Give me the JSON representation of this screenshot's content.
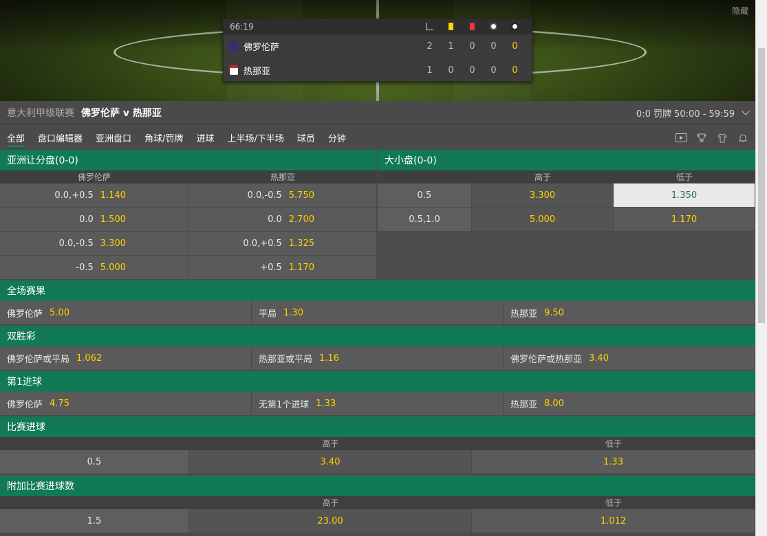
{
  "header": {
    "hide_label": "隐藏"
  },
  "scoreboard": {
    "time": "66:19",
    "teams": [
      {
        "name": "佛罗伦萨",
        "corners": "2",
        "yellow": "1",
        "red": "0",
        "pen": "0",
        "goals": "0",
        "shirt_color": "#3a2a7a"
      },
      {
        "name": "热那亚",
        "corners": "1",
        "yellow": "0",
        "red": "0",
        "pen": "0",
        "goals": "0",
        "shirt_color": "#c62828"
      }
    ],
    "icons": [
      "corner-icon",
      "yellow-card-icon",
      "red-card-icon",
      "penalty-icon",
      "goal-icon"
    ]
  },
  "title": {
    "league": "意大利甲级联赛",
    "match": "佛罗伦萨 v 热那亚",
    "status": "0:0 罚牌 50:00 - 59:59"
  },
  "tabs": [
    "全部",
    "盘口编辑器",
    "亚洲盘口",
    "角球/罚牌",
    "进球",
    "上半场/下半场",
    "球员",
    "分钟"
  ],
  "handicap": {
    "title": "亚洲让分盘(0-0)",
    "col_home": "佛罗伦萨",
    "col_away": "热那亚",
    "rows": [
      {
        "h_line": "0.0,+0.5",
        "h_odd": "1.140",
        "a_line": "0.0,-0.5",
        "a_odd": "5.750"
      },
      {
        "h_line": "0.0",
        "h_odd": "1.500",
        "a_line": "0.0",
        "a_odd": "2.700"
      },
      {
        "h_line": "0.0,-0.5",
        "h_odd": "3.300",
        "a_line": "0.0,+0.5",
        "a_odd": "1.325"
      },
      {
        "h_line": "-0.5",
        "h_odd": "5.000",
        "a_line": "+0.5",
        "a_odd": "1.170"
      }
    ]
  },
  "totals": {
    "title": "大小盘(0-0)",
    "col_over": "高于",
    "col_under": "低于",
    "rows": [
      {
        "line": "0.5",
        "over": "3.300",
        "under": "1.350"
      },
      {
        "line": "0.5,1.0",
        "over": "5.000",
        "under": "1.170"
      }
    ]
  },
  "fulltime": {
    "title": "全场赛果",
    "items": [
      {
        "label": "佛罗伦萨",
        "odd": "5.00"
      },
      {
        "label": "平局",
        "odd": "1.30"
      },
      {
        "label": "热那亚",
        "odd": "9.50"
      }
    ]
  },
  "double_chance": {
    "title": "双胜彩",
    "items": [
      {
        "label": "佛罗伦萨或平局",
        "odd": "1.062"
      },
      {
        "label": "热那亚或平局",
        "odd": "1.16"
      },
      {
        "label": "佛罗伦萨或热那亚",
        "odd": "3.40"
      }
    ]
  },
  "first_goal": {
    "title": "第1进球",
    "items": [
      {
        "label": "佛罗伦萨",
        "odd": "4.75"
      },
      {
        "label": "无第1个进球",
        "odd": "1.33"
      },
      {
        "label": "热那亚",
        "odd": "8.00"
      }
    ]
  },
  "match_goals": {
    "title": "比赛进球",
    "col_over": "高于",
    "col_under": "低于",
    "line": "0.5",
    "over": "3.40",
    "under": "1.33"
  },
  "extra_goals": {
    "title": "附加比赛进球数",
    "col_over": "高于",
    "col_under": "低于",
    "line": "1.5",
    "over": "23.00",
    "under": "1.012"
  }
}
